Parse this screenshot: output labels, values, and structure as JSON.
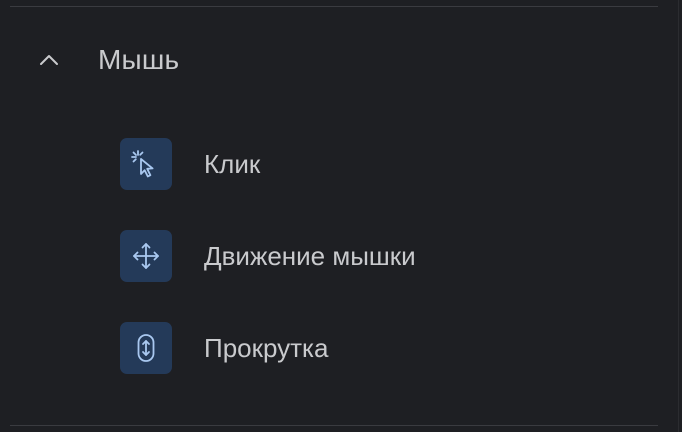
{
  "section": {
    "title": "Мышь",
    "expanded": true,
    "toggle_icon": "chevron-up-icon"
  },
  "items": [
    {
      "label": "Клик",
      "icon": "click-cursor-icon"
    },
    {
      "label": "Движение мышки",
      "icon": "move-arrows-icon"
    },
    {
      "label": "Прокрутка",
      "icon": "scroll-wheel-icon"
    }
  ],
  "colors": {
    "background": "#1e1f23",
    "text": "#c9cacd",
    "icon_tile": "#243a59",
    "icon_stroke": "#a9c8f0",
    "divider": "#3a3b40"
  }
}
